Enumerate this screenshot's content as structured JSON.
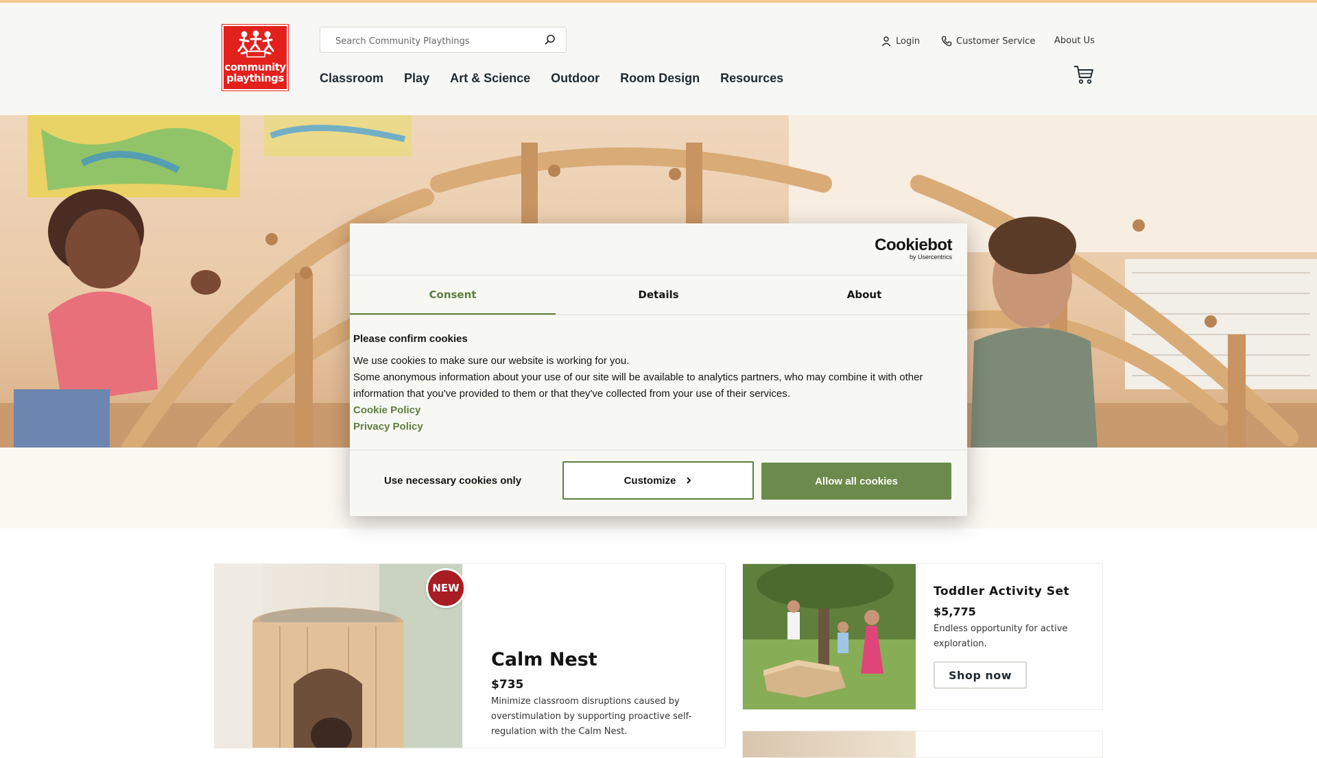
{
  "header": {
    "logo_top": "community",
    "logo_bottom": "playthings",
    "search_placeholder": "Search Community Playthings",
    "nav": [
      "Classroom",
      "Play",
      "Art & Science",
      "Outdoor",
      "Room Design",
      "Resources"
    ],
    "utility": {
      "login": "Login",
      "customer_service": "Customer Service",
      "about": "About Us"
    }
  },
  "cookie_dialog": {
    "brand": "Cookiebot",
    "brand_sub": "by Usercentrics",
    "tabs": [
      "Consent",
      "Details",
      "About"
    ],
    "active_tab": "Consent",
    "heading": "Please confirm cookies",
    "line1": "We use cookies to make sure our website is working for you.",
    "line2": "Some anonymous information about your use of our site will be available to analytics partners, who may combine it with other information that you've provided to them or that they've collected from your use of their services.",
    "link_cookie": "Cookie Policy",
    "link_privacy": "Privacy Policy",
    "btn_necessary": "Use necessary cookies only",
    "btn_customize": "Customize",
    "btn_allow": "Allow all cookies",
    "accent_color": "#5e7d3e"
  },
  "products": {
    "featured": {
      "badge": "NEW",
      "title": "Calm Nest",
      "price": "$735",
      "description": "Minimize classroom disruptions caused by overstimulation by supporting proactive self-regulation with the Calm Nest."
    },
    "side": {
      "title": "Toddler Activity Set",
      "price": "$5,775",
      "description": "Endless opportunity for active exploration.",
      "cta": "Shop now"
    }
  },
  "colors": {
    "brand_red": "#e2201c",
    "header_bg": "#f7f7f5",
    "top_line": "#f3c995"
  }
}
